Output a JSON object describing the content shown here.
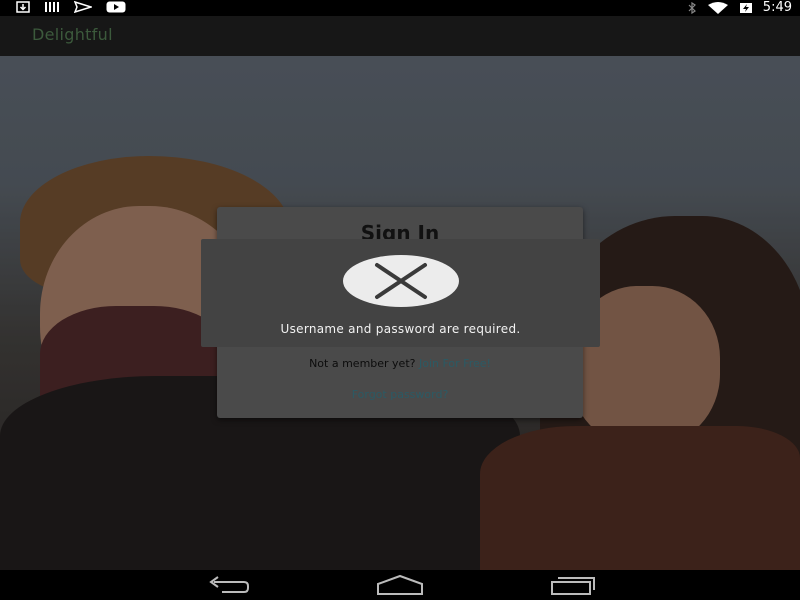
{
  "status_bar": {
    "time": "5:49",
    "left_icons": [
      "download-icon",
      "barcode-icon",
      "send-icon",
      "youtube-icon"
    ],
    "right_icons": [
      "bluetooth-icon",
      "wifi-icon",
      "battery-charging-icon"
    ]
  },
  "app": {
    "title": "Delightful"
  },
  "signin": {
    "title": "Sign In",
    "member_prompt": "Not a member yet?",
    "join_link": "Join For Free!",
    "forgot_link": "Forgot password?"
  },
  "alert": {
    "icon": "close-x-icon",
    "message": "Username and password are required."
  },
  "nav_bar": {
    "buttons": [
      "back-icon",
      "home-icon",
      "recents-icon"
    ]
  },
  "colors": {
    "action_bar": "#171717",
    "app_title": "#3c5a3c",
    "link": "#2b5a64",
    "card": "#4a4a4a",
    "alert": "#434343"
  }
}
